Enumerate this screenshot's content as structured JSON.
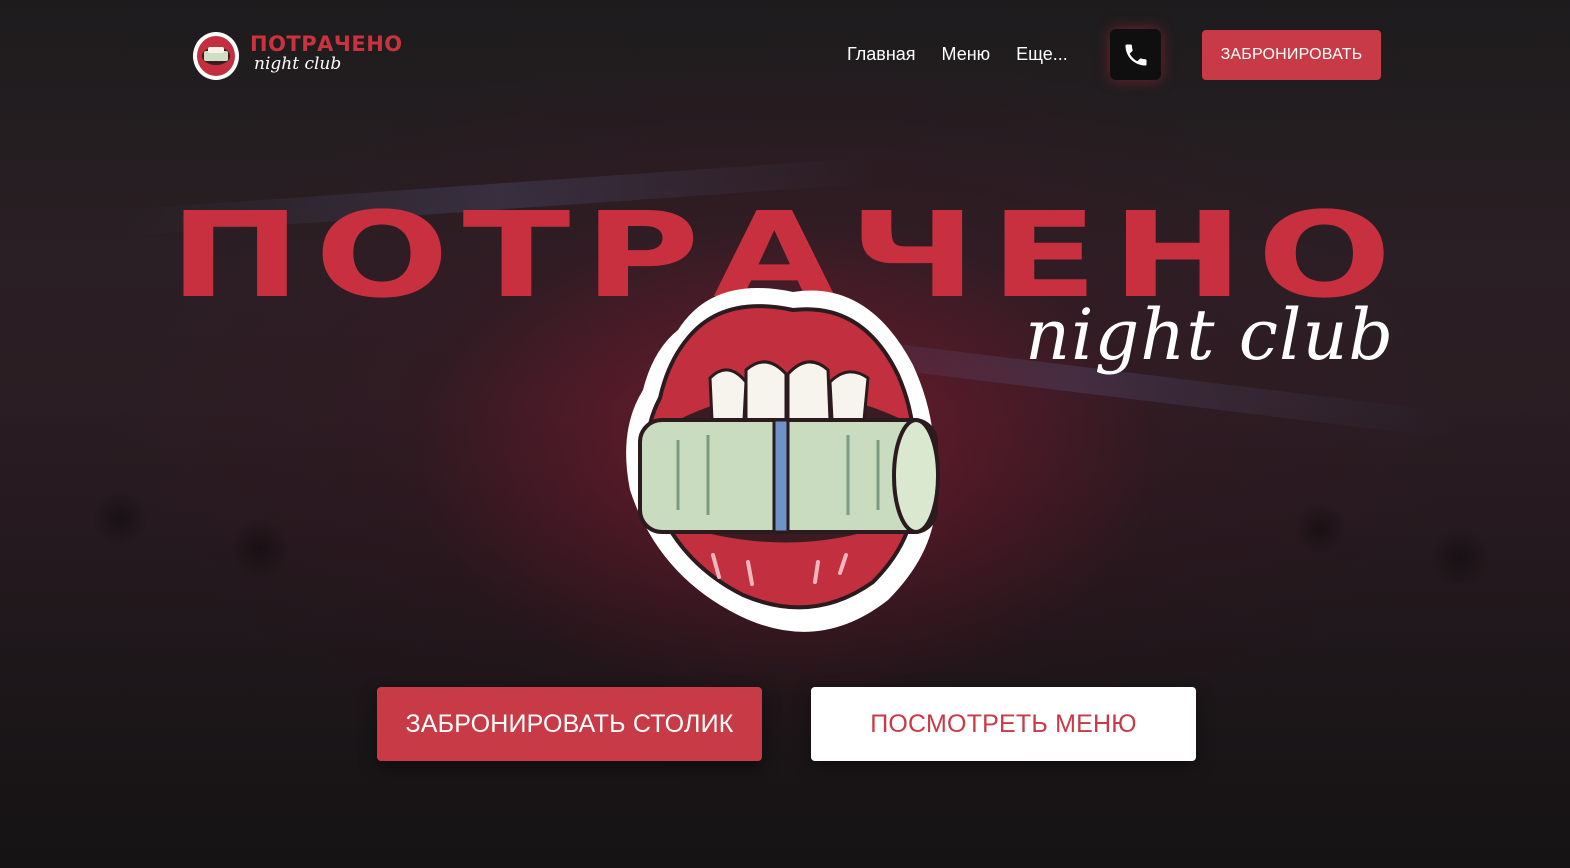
{
  "colors": {
    "accent": "#c83a46",
    "title_red": "#c8303f",
    "background": "#1c1a1b",
    "white": "#ffffff"
  },
  "header": {
    "logo_title": "ПОТРАЧЕНО",
    "logo_subtitle": "night club",
    "nav": [
      {
        "label": "Главная"
      },
      {
        "label": "Меню"
      },
      {
        "label": "Еще..."
      }
    ],
    "phone_icon": "phone-icon",
    "book_label": "ЗАБРОНИРОВАТЬ"
  },
  "hero": {
    "title": "ПОТРАЧЕНО",
    "subtitle": "night club",
    "sticker": "lips-with-money-roll",
    "primary_cta": "ЗАБРОНИРОВАТЬ СТОЛИК",
    "secondary_cta": "ПОСМОТРЕТЬ МЕНЮ"
  }
}
